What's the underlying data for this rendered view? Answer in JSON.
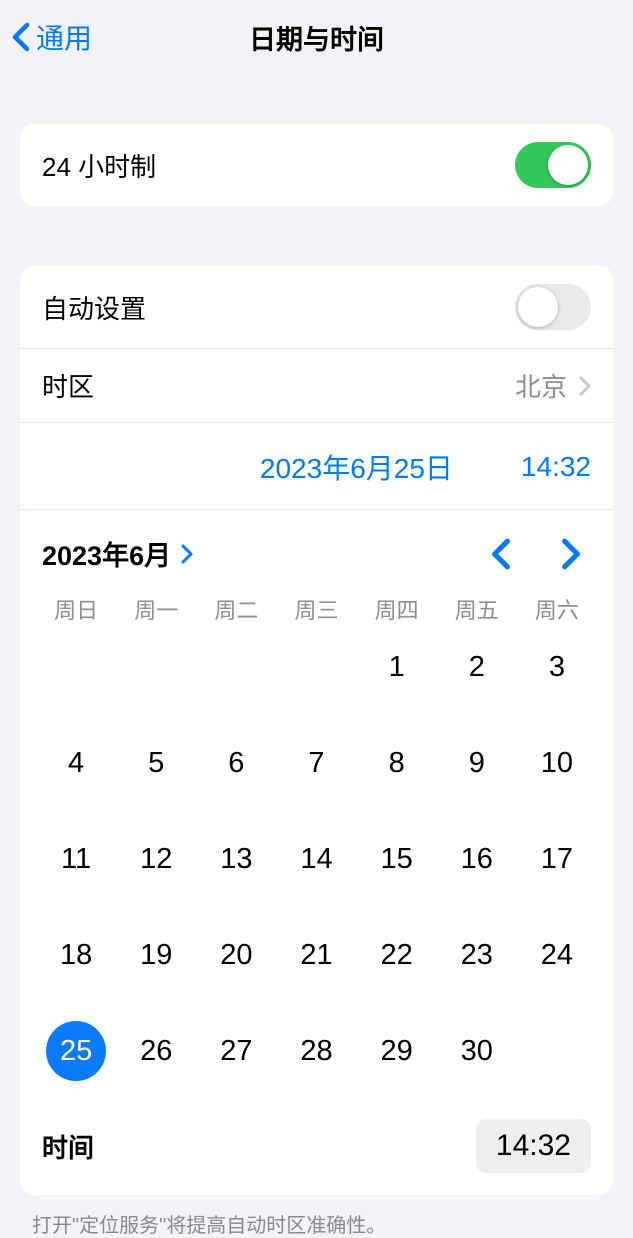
{
  "header": {
    "back_label": "通用",
    "title": "日期与时间"
  },
  "settings": {
    "time_format_24h": {
      "label": "24 小时制",
      "on": true
    },
    "auto_set": {
      "label": "自动设置",
      "on": false
    },
    "timezone": {
      "label": "时区",
      "value": "北京"
    }
  },
  "date_time": {
    "date_label": "2023年6月25日",
    "time_label": "14:32"
  },
  "calendar": {
    "month_label": "2023年6月",
    "weekdays": [
      "周日",
      "周一",
      "周二",
      "周三",
      "周四",
      "周五",
      "周六"
    ],
    "leading_blanks": 4,
    "days_in_month": 30,
    "selected_day": 25
  },
  "time_row": {
    "label": "时间",
    "value": "14:32"
  },
  "footer": "打开\"定位服务\"将提高自动时区准确性。"
}
